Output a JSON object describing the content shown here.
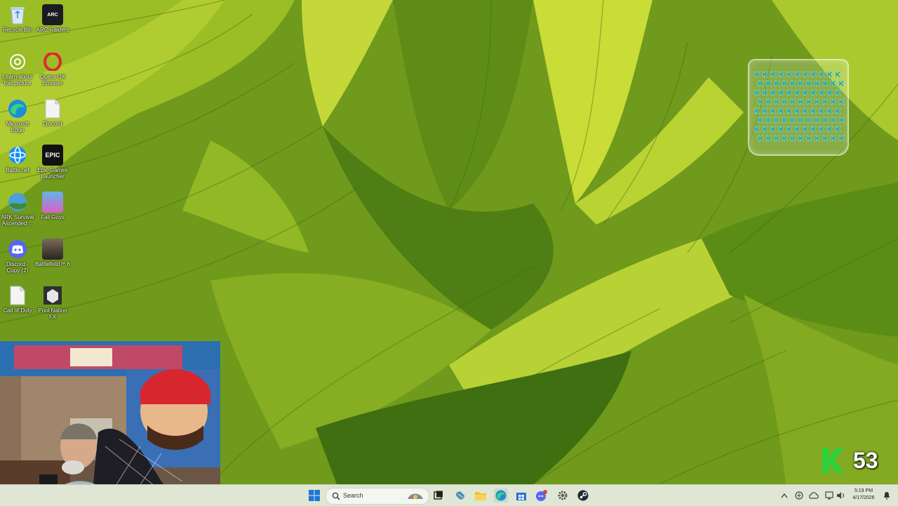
{
  "desktop": {
    "icons": [
      {
        "label": "Recycle Bin"
      },
      {
        "label": "ARC Raiders"
      },
      {
        "label": "Learn about this picture"
      },
      {
        "label": "Opera GX Browser"
      },
      {
        "label": "Microsoft Edge"
      },
      {
        "label": "Discord"
      },
      {
        "label": "Battle.net"
      },
      {
        "label": "Epic Games Launcher"
      },
      {
        "label": "ARK Survival Ascended ..."
      },
      {
        "label": "Fall Guys"
      },
      {
        "label": "Discord - Copy (2)"
      },
      {
        "label": "Battlefield™ 6"
      },
      {
        "label": "Call of Duty"
      },
      {
        "label": "Pool Nation FX"
      }
    ],
    "epic_glyph": "EPIC",
    "arc_glyph": "ARC"
  },
  "widget": {
    "k_count": "53"
  },
  "taskbar": {
    "search_placeholder": "Search",
    "clock_time": "5:19 PM",
    "clock_date": "4/17/2026"
  },
  "colors": {
    "taskbar_bg": "#dfe6d4",
    "k_green": "#2fd13a",
    "jar_item": "#2a9e9a"
  }
}
